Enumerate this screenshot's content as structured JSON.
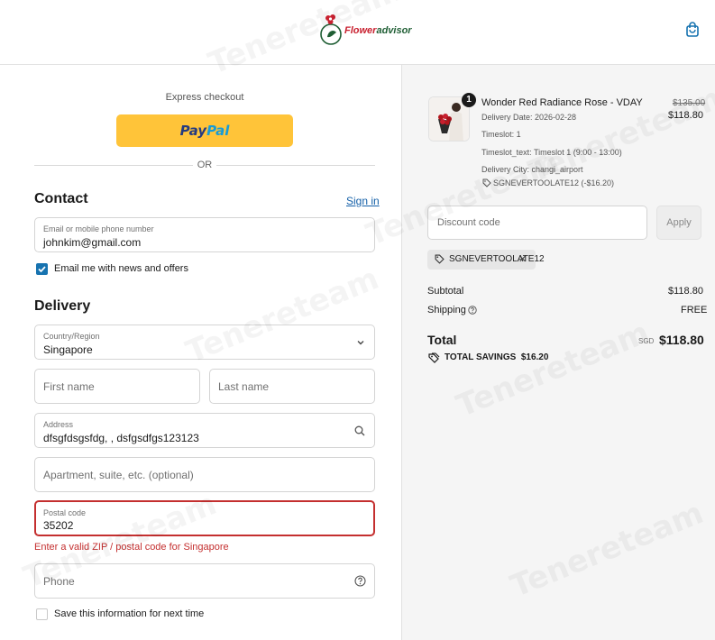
{
  "header": {
    "logo_text_part1": "Flower",
    "logo_text_part2": "advisor",
    "cart_icon": "shopping-bag-icon"
  },
  "express": {
    "label": "Express checkout",
    "paypal_part1": "Pay",
    "paypal_part2": "Pal",
    "or_label": "OR"
  },
  "contact": {
    "title": "Contact",
    "signin_label": "Sign in",
    "email_label": "Email or mobile phone number",
    "email_value": "johnkim@gmail.com",
    "news_label": "Email me with news and offers",
    "news_checked": true
  },
  "delivery": {
    "title": "Delivery",
    "country_label": "Country/Region",
    "country_value": "Singapore",
    "first_name_placeholder": "First name",
    "last_name_placeholder": "Last name",
    "address_label": "Address",
    "address_value": "dfsgfdsgsfdg, , dsfgsdfgs123123",
    "apartment_placeholder": "Apartment, suite, etc. (optional)",
    "postal_label": "Postal code",
    "postal_value": "35202",
    "postal_error": "Enter a valid ZIP / postal code for Singapore",
    "phone_placeholder": "Phone",
    "save_label": "Save this information for next time",
    "save_checked": false
  },
  "order": {
    "quantity": "1",
    "product_name": "Wonder Red Radiance Rose - VDAY",
    "original_price": "$135.00",
    "price": "$118.80",
    "delivery_date": "Delivery Date: 2026-02-28",
    "timeslot": "Timeslot: 1",
    "timeslot_text": "Timeslot_text: Timeslot 1 (9:00 - 13:00)",
    "delivery_city": "Delivery City: changi_airport",
    "item_discount": "SGNEVERTOOLATE12 (-$16.20)"
  },
  "discount": {
    "placeholder": "Discount code",
    "apply_label": "Apply",
    "applied_code": "SGNEVERTOOLATE12"
  },
  "summary": {
    "subtotal_label": "Subtotal",
    "subtotal_value": "$118.80",
    "shipping_label": "Shipping",
    "shipping_value": "FREE",
    "total_label": "Total",
    "currency": "SGD",
    "total_value": "$118.80",
    "savings_label": "TOTAL SAVINGS",
    "savings_value": "$16.20"
  },
  "watermark_text": "Tenereteam",
  "colors": {
    "accent": "#1773b0",
    "paypal": "#ffc439",
    "error": "#c42f2f",
    "panel": "#f5f5f5"
  }
}
